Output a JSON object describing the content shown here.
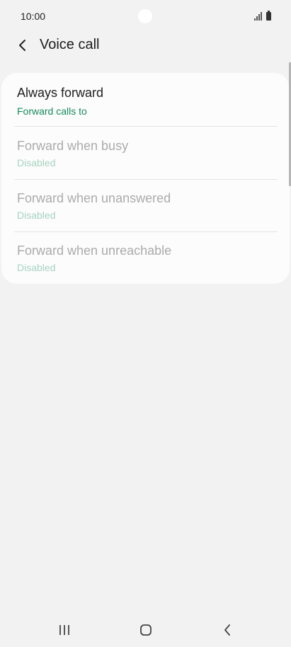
{
  "status_bar": {
    "time": "10:00",
    "icons": [
      "signal-icon",
      "battery-icon"
    ]
  },
  "header": {
    "back_icon": "chevron-left-icon",
    "title": "Voice call"
  },
  "list": {
    "items": [
      {
        "title": "Always forward",
        "subtitle": "Forward calls to",
        "enabled": true
      },
      {
        "title": "Forward when busy",
        "subtitle": "Disabled",
        "enabled": false
      },
      {
        "title": "Forward when unanswered",
        "subtitle": "Disabled",
        "enabled": false
      },
      {
        "title": "Forward when unreachable",
        "subtitle": "Disabled",
        "enabled": false
      }
    ]
  },
  "nav_bar": {
    "icons": [
      "recent-apps-icon",
      "home-icon",
      "back-icon"
    ]
  },
  "colors": {
    "accent": "#168a5b",
    "accent_disabled": "#a7d3c2",
    "title_enabled": "#1f1f1f",
    "title_disabled": "#ababab",
    "background": "#f2f2f2",
    "card": "#fcfcfc"
  }
}
